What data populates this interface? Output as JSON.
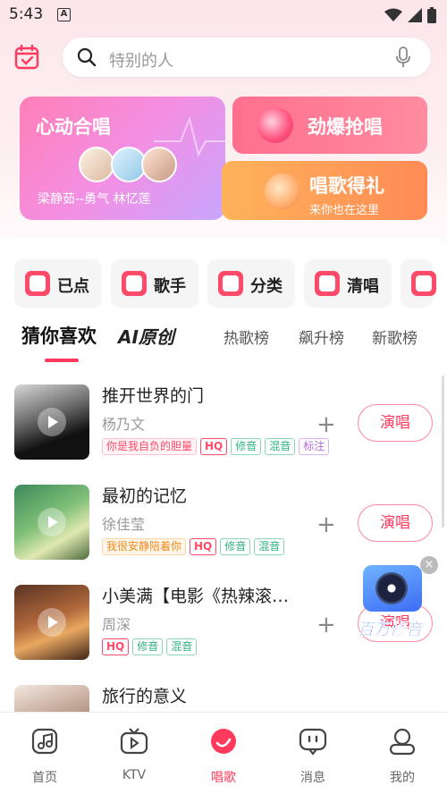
{
  "status_bar": {
    "time": "5:43",
    "notif_letter": "A"
  },
  "search": {
    "placeholder": "特别的人"
  },
  "banners": {
    "duet": {
      "title": "心动合唱",
      "subtitle": "梁静茹--勇气     林忆莲"
    },
    "rush": {
      "title": "劲爆抢唱"
    },
    "gift": {
      "title": "唱歌得礼",
      "subtitle": "来你也在这里"
    }
  },
  "categories": [
    {
      "label": "已点",
      "icon": "music-note-icon"
    },
    {
      "label": "歌手",
      "icon": "grid-icon"
    },
    {
      "label": "分类",
      "icon": "category-icon"
    },
    {
      "label": "清唱",
      "icon": "mic-icon"
    }
  ],
  "tabs": [
    "猜你喜欢",
    "AI原创",
    "热歌榜",
    "飙升榜",
    "新歌榜"
  ],
  "songs": [
    {
      "title": "推开世界的门",
      "artist": "杨乃文",
      "sing": "演唱",
      "tags": [
        {
          "text": "你是我自负的胆量",
          "style": "pink"
        },
        {
          "text": "HQ",
          "style": "hq"
        },
        {
          "text": "修音",
          "style": "green"
        },
        {
          "text": "混音",
          "style": "green"
        },
        {
          "text": "标注",
          "style": "purple"
        }
      ]
    },
    {
      "title": "最初的记忆",
      "artist": "徐佳莹",
      "sing": "演唱",
      "tags": [
        {
          "text": "我很安静陪着你",
          "style": "orange"
        },
        {
          "text": "HQ",
          "style": "hq"
        },
        {
          "text": "修音",
          "style": "green"
        },
        {
          "text": "混音",
          "style": "green"
        }
      ]
    },
    {
      "title": "小美满【电影《热辣滚…",
      "artist": "周深",
      "sing": "演唱",
      "tags": [
        {
          "text": "HQ",
          "style": "hq"
        },
        {
          "text": "修音",
          "style": "green"
        },
        {
          "text": "混音",
          "style": "green"
        }
      ]
    },
    {
      "title": "旅行的意义",
      "artist": "",
      "sing": "",
      "tags": []
    }
  ],
  "float_ad": {
    "label": "百万修音",
    "close": "×"
  },
  "nav": [
    {
      "label": "首页",
      "icon": "home-icon"
    },
    {
      "label": "KTV",
      "icon": "ktv-icon"
    },
    {
      "label": "唱歌",
      "icon": "sing-icon",
      "active": true
    },
    {
      "label": "消息",
      "icon": "message-icon"
    },
    {
      "label": "我的",
      "icon": "profile-icon"
    }
  ],
  "colors": {
    "accent": "#ff3a5c"
  }
}
